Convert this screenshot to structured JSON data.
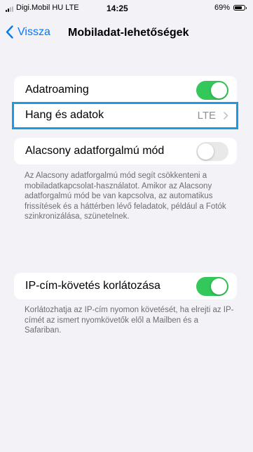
{
  "status": {
    "carrier": "Digi.Mobil HU  LTE",
    "time": "14:25",
    "battery": "69%",
    "battery_level": 0.69
  },
  "nav": {
    "back_label": "Vissza",
    "title": "Mobiladat-lehetőségek"
  },
  "group1": {
    "roaming_label": "Adatroaming",
    "roaming_on": true,
    "voice_label": "Hang és adatok",
    "voice_value": "LTE"
  },
  "group2": {
    "low_data_label": "Alacsony adatforgalmú mód",
    "low_data_on": false,
    "footnote": "Az Alacsony adatforgalmú mód segít csökkenteni a mobiladatkapcsolat-használatot. Amikor az Alacsony adatforgalmú mód be van kapcsolva, az automatikus frissítések és a háttérben lévő feladatok, például a Fotók szinkronizálása, szünetelnek."
  },
  "group3": {
    "ip_label": "IP-cím-követés korlátozása",
    "ip_on": true,
    "footnote": "Korlátozhatja az IP-cím nyomon követését, ha elrejti az IP-címét az ismert nyomkövetők elől a Mailben és a Safariban."
  },
  "colors": {
    "accent": "#007aff",
    "toggle_on": "#34c759",
    "highlight": "#1a9be6"
  }
}
